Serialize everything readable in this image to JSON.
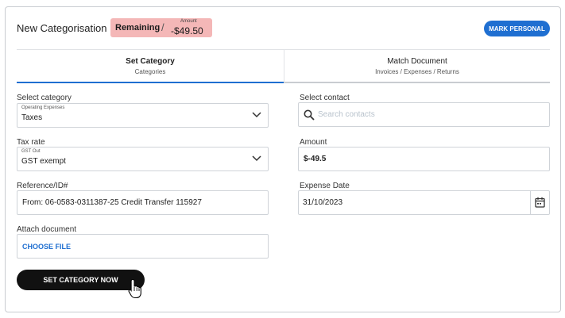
{
  "header": {
    "title": "New Categorisation",
    "remaining_label": "Remaining",
    "separator": "/",
    "amount_caption": "Amount",
    "amount_value": "-$49.50",
    "mark_personal_label": "MARK PERSONAL",
    "remaining_color": "#f4b7b7"
  },
  "tabs": [
    {
      "title": "Set Category",
      "subtitle": "Categories",
      "active": true
    },
    {
      "title": "Match Document",
      "subtitle": "Invoices / Expenses / Returns",
      "active": false
    }
  ],
  "form": {
    "category": {
      "label": "Select category",
      "caption": "Operating Expenses",
      "value": "Taxes"
    },
    "contact": {
      "label": "Select contact",
      "placeholder": "Search contacts"
    },
    "tax_rate": {
      "label": "Tax rate",
      "caption": "GST Out",
      "value": "GST exempt"
    },
    "amount": {
      "label": "Amount",
      "value": "$-49.5"
    },
    "reference": {
      "label": "Reference/ID#",
      "value": "From: 06-0583-0311387-25 Credit Transfer 115927"
    },
    "expense_date": {
      "label": "Expense Date",
      "value": "31/10/2023"
    },
    "attach": {
      "label": "Attach document",
      "button_label": "CHOOSE FILE"
    }
  },
  "actions": {
    "set_category_label": "SET CATEGORY NOW"
  },
  "colors": {
    "accent": "#1f6fd1",
    "primary_button": "#111111"
  }
}
